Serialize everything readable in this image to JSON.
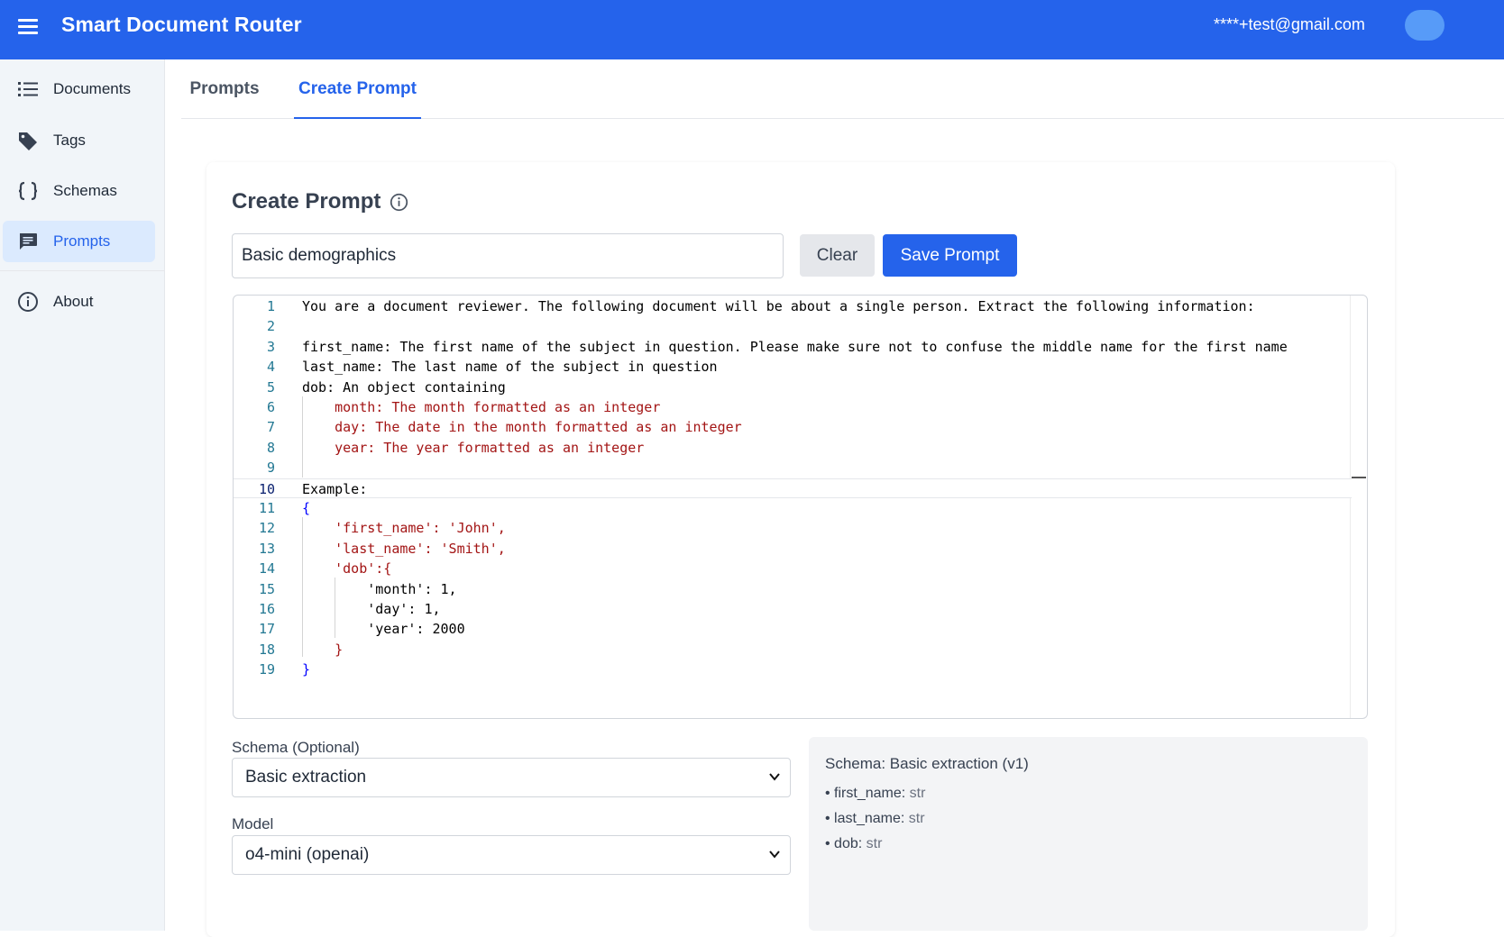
{
  "app": {
    "title": "Smart Document Router",
    "user_email": "****+test@gmail.com",
    "colors": {
      "primary": "#2563eb",
      "active_bg": "#dbeafe"
    }
  },
  "sidebar": {
    "items": [
      {
        "label": "Documents",
        "icon": "list-icon"
      },
      {
        "label": "Tags",
        "icon": "tag-icon"
      },
      {
        "label": "Schemas",
        "icon": "braces-icon"
      },
      {
        "label": "Prompts",
        "icon": "chat-icon",
        "active": true
      },
      {
        "label": "About",
        "icon": "info-icon"
      }
    ]
  },
  "tabs": [
    {
      "label": "Prompts"
    },
    {
      "label": "Create Prompt",
      "active": true
    }
  ],
  "form": {
    "title": "Create Prompt",
    "name_value": "Basic demographics",
    "clear_label": "Clear",
    "save_label": "Save Prompt",
    "schema_label": "Schema (Optional)",
    "schema_value": "Basic extraction",
    "model_label": "Model",
    "model_value": "o4-mini (openai)"
  },
  "editor": {
    "current_line": 10,
    "lines": [
      {
        "n": "1",
        "text": "You are a document reviewer. The following document will be about a single person. Extract the following information:"
      },
      {
        "n": "2",
        "text": ""
      },
      {
        "n": "3",
        "text": "first_name: The first name of the subject in question. Please make sure not to confuse the middle name for the first name"
      },
      {
        "n": "4",
        "text": "last_name: The last name of the subject in question"
      },
      {
        "n": "5",
        "text": "dob: An object containing"
      },
      {
        "n": "6",
        "text": "    month: The month formatted as an integer"
      },
      {
        "n": "7",
        "text": "    day: The date in the month formatted as an integer"
      },
      {
        "n": "8",
        "text": "    year: The year formatted as an integer"
      },
      {
        "n": "9",
        "text": ""
      },
      {
        "n": "10",
        "text": "Example:"
      },
      {
        "n": "11",
        "text": "{"
      },
      {
        "n": "12",
        "text": "    'first_name': 'John',"
      },
      {
        "n": "13",
        "text": "    'last_name': 'Smith',"
      },
      {
        "n": "14",
        "text": "    'dob':{"
      },
      {
        "n": "15",
        "text": "        'month': 1,"
      },
      {
        "n": "16",
        "text": "        'day': 1,"
      },
      {
        "n": "17",
        "text": "        'year': 2000"
      },
      {
        "n": "18",
        "text": "    }"
      },
      {
        "n": "19",
        "text": "}"
      }
    ]
  },
  "schema_preview": {
    "title": "Schema: Basic extraction (v1)",
    "fields": [
      {
        "name": "first_name",
        "type": "str"
      },
      {
        "name": "last_name",
        "type": "str"
      },
      {
        "name": "dob",
        "type": "str"
      }
    ]
  }
}
